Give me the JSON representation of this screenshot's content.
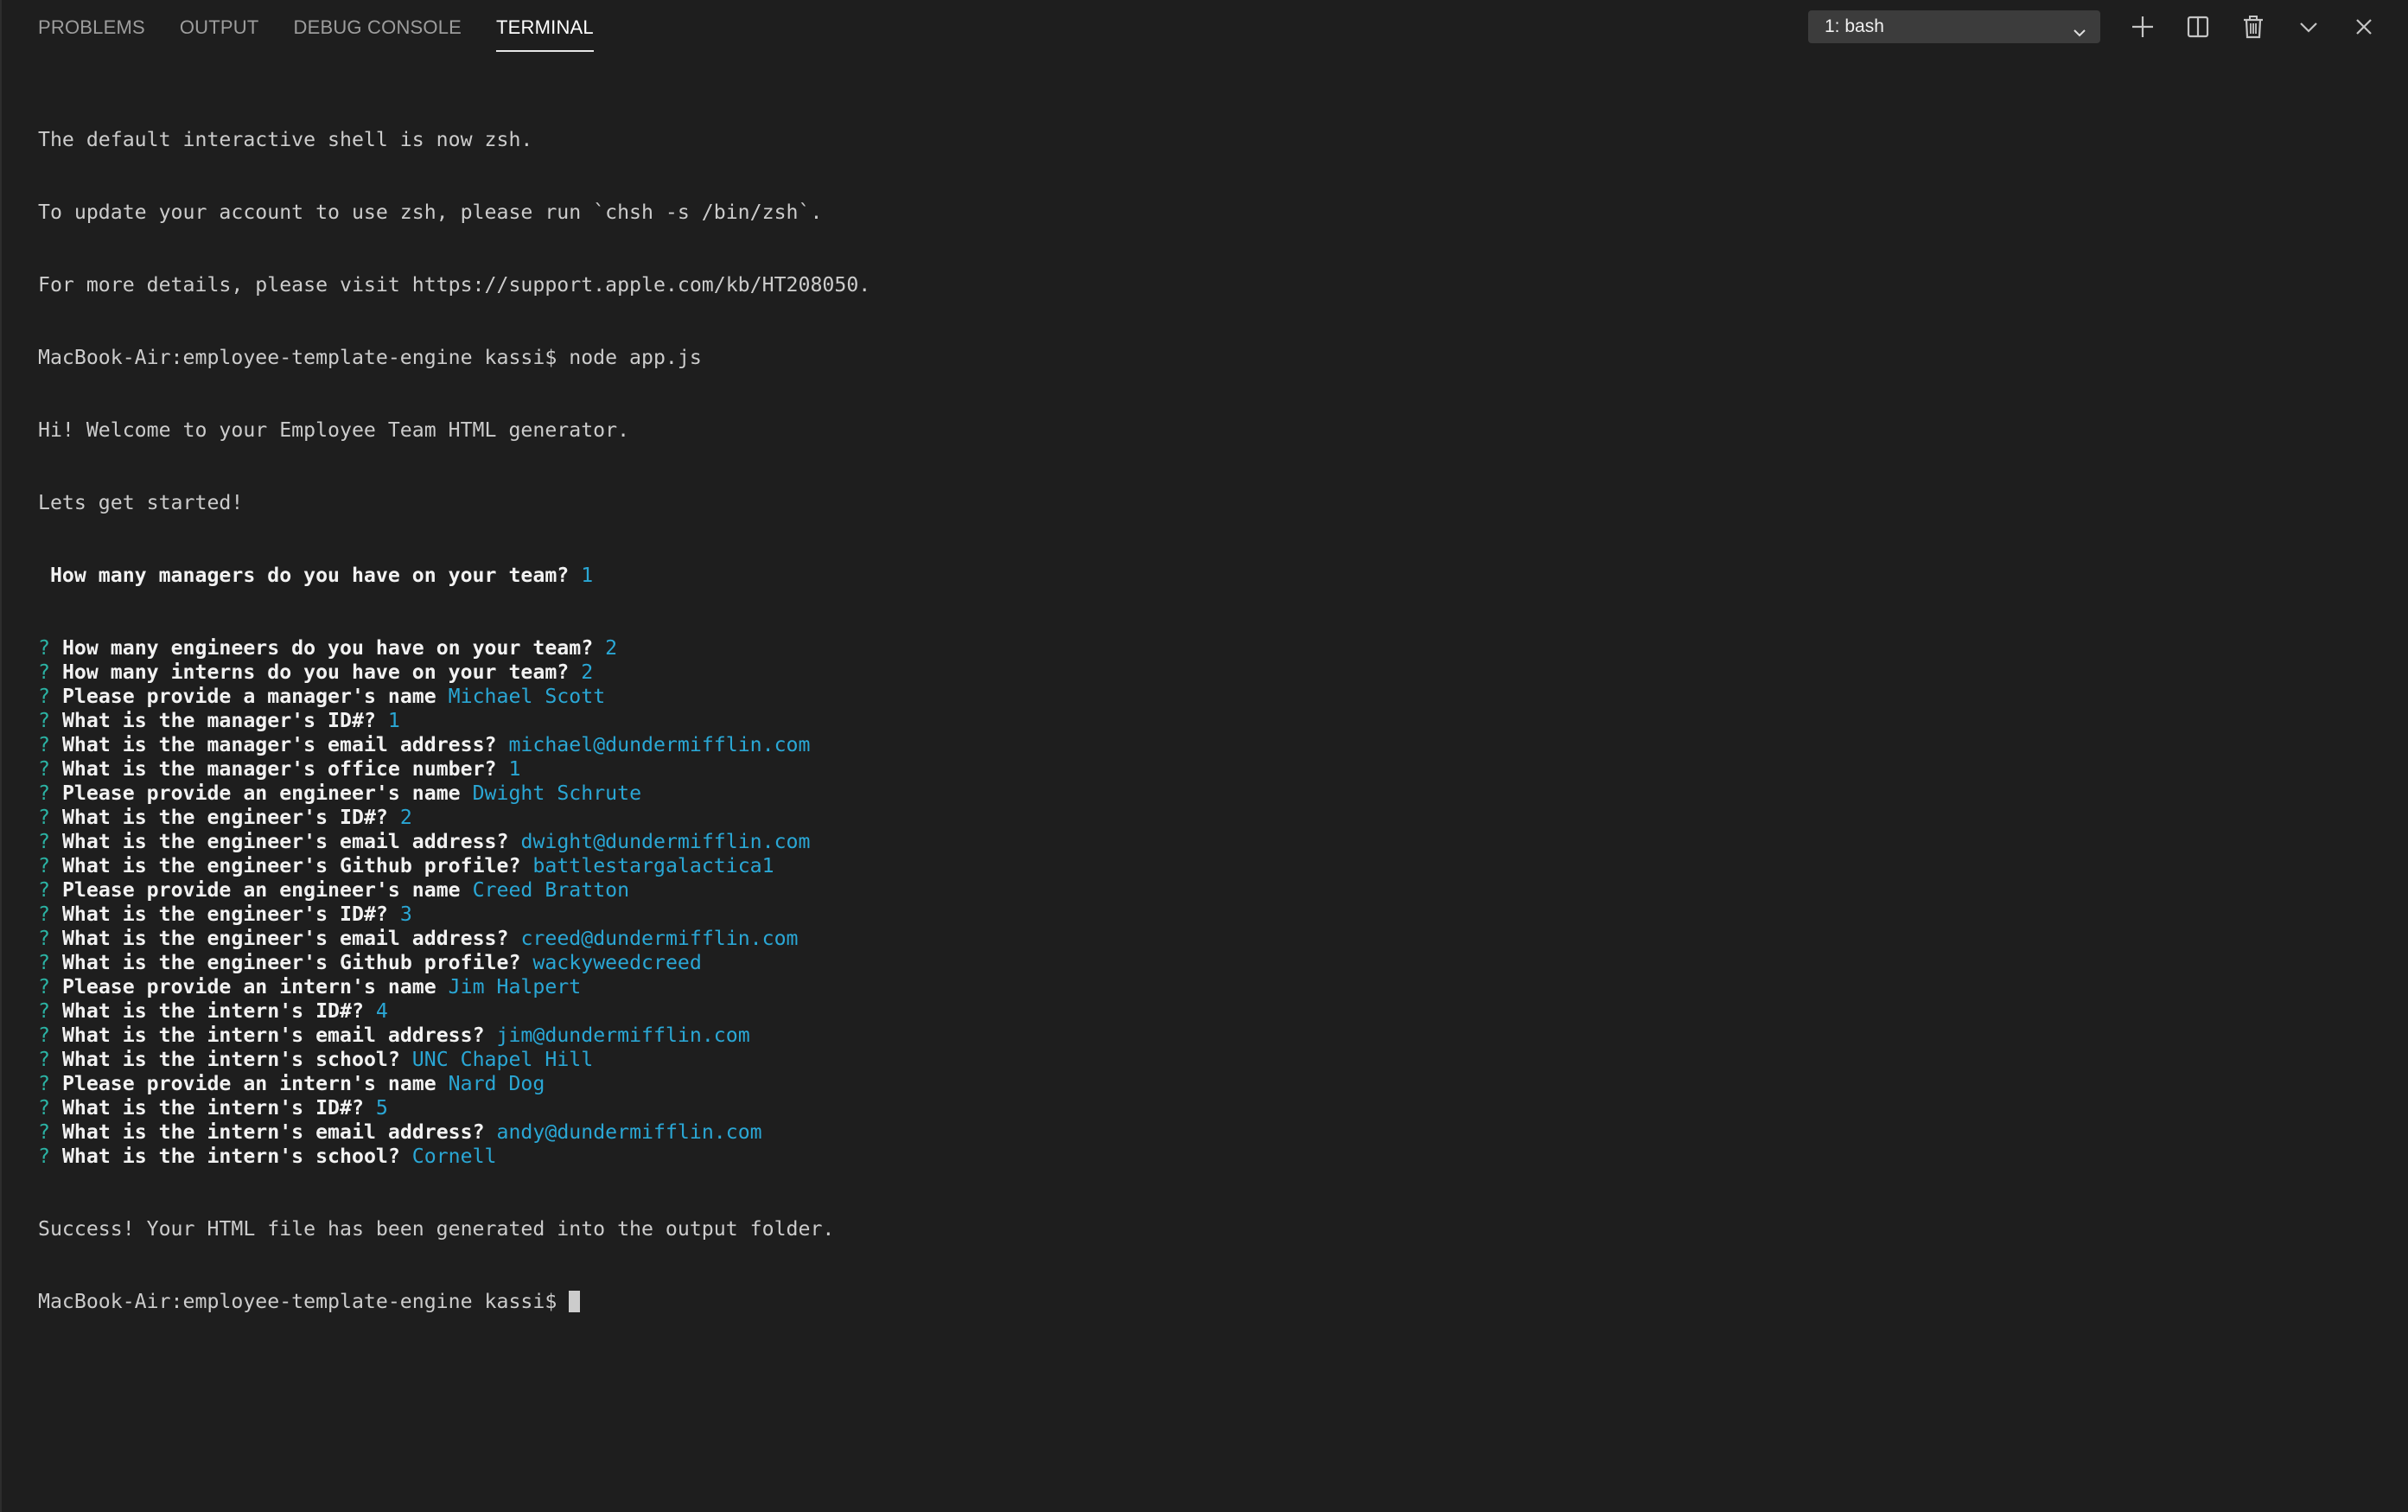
{
  "panel": {
    "tabs": [
      {
        "label": "PROBLEMS",
        "active": false
      },
      {
        "label": "OUTPUT",
        "active": false
      },
      {
        "label": "DEBUG CONSOLE",
        "active": false
      },
      {
        "label": "TERMINAL",
        "active": true
      }
    ],
    "shell_selector": {
      "value": "1: bash"
    },
    "actions": [
      {
        "icon": "plus-icon"
      },
      {
        "icon": "split-icon"
      },
      {
        "icon": "trash-icon"
      },
      {
        "icon": "chevron-down-icon"
      },
      {
        "icon": "close-icon"
      }
    ]
  },
  "terminal": {
    "intro_lines": [
      "The default interactive shell is now zsh.",
      "To update your account to use zsh, please run `chsh -s /bin/zsh`.",
      "For more details, please visit https://support.apple.com/kb/HT208050.",
      "MacBook-Air:employee-template-engine kassi$ node app.js",
      "Hi! Welcome to your Employee Team HTML generator.",
      "Lets get started!"
    ],
    "first_question": {
      "question": " How many managers do you have on your team?",
      "answer": "1"
    },
    "questions": [
      {
        "question": "How many engineers do you have on your team?",
        "answer": "2"
      },
      {
        "question": "How many interns do you have on your team?",
        "answer": "2"
      },
      {
        "question": "Please provide a manager's name",
        "answer": "Michael Scott"
      },
      {
        "question": "What is the manager's ID#?",
        "answer": "1"
      },
      {
        "question": "What is the manager's email address?",
        "answer": "michael@dundermifflin.com"
      },
      {
        "question": "What is the manager's office number?",
        "answer": "1"
      },
      {
        "question": "Please provide an engineer's name",
        "answer": "Dwight Schrute"
      },
      {
        "question": "What is the engineer's ID#?",
        "answer": "2"
      },
      {
        "question": "What is the engineer's email address?",
        "answer": "dwight@dundermifflin.com"
      },
      {
        "question": "What is the engineer's Github profile?",
        "answer": "battlestargalactica1"
      },
      {
        "question": "Please provide an engineer's name",
        "answer": "Creed Bratton"
      },
      {
        "question": "What is the engineer's ID#?",
        "answer": "3"
      },
      {
        "question": "What is the engineer's email address?",
        "answer": "creed@dundermifflin.com"
      },
      {
        "question": "What is the engineer's Github profile?",
        "answer": "wackyweedcreed"
      },
      {
        "question": "Please provide an intern's name",
        "answer": "Jim Halpert"
      },
      {
        "question": "What is the intern's ID#?",
        "answer": "4"
      },
      {
        "question": "What is the intern's email address?",
        "answer": "jim@dundermifflin.com"
      },
      {
        "question": "What is the intern's school?",
        "answer": "UNC Chapel Hill"
      },
      {
        "question": "Please provide an intern's name",
        "answer": "Nard Dog"
      },
      {
        "question": "What is the intern's ID#?",
        "answer": "5"
      },
      {
        "question": "What is the intern's email address?",
        "answer": "andy@dundermifflin.com"
      },
      {
        "question": "What is the intern's school?",
        "answer": "Cornell"
      }
    ],
    "question_mark": "?",
    "success_line": "Success! Your HTML file has been generated into the output folder.",
    "prompt_line": "MacBook-Air:employee-template-engine kassi$ "
  },
  "colors": {
    "background": "#1e1e1e",
    "text": "#cccccc",
    "question_mark": "#2bb3a4",
    "answer": "#2aa7d5",
    "active_tab": "#ffffff",
    "inactive_tab": "#9d9d9d"
  }
}
